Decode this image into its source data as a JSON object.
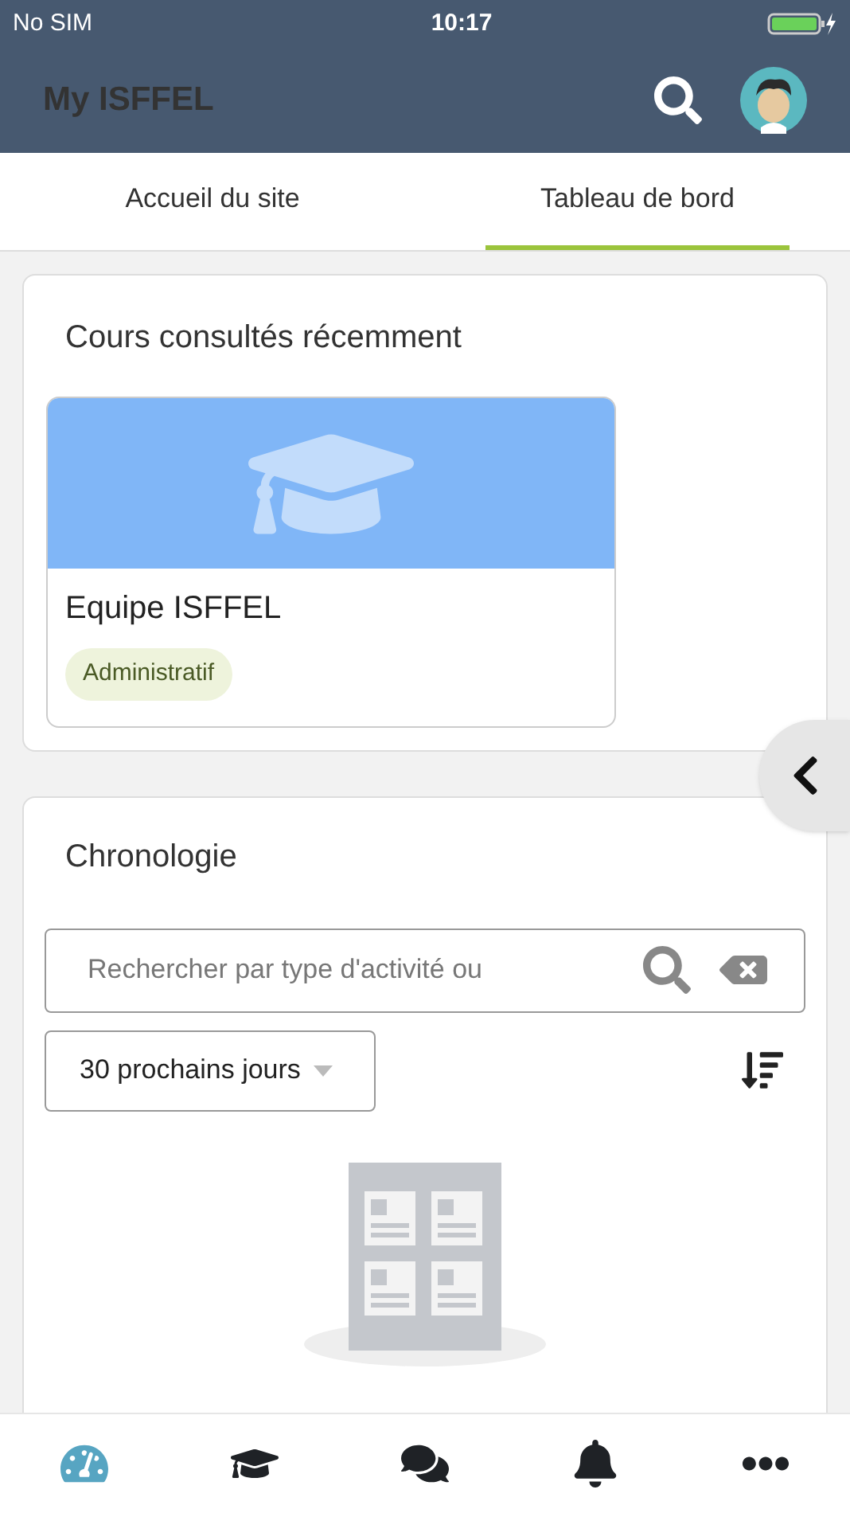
{
  "status_bar": {
    "carrier": "No SIM",
    "time": "10:17"
  },
  "header": {
    "title": "My ISFFEL"
  },
  "tabs": [
    {
      "label": "Accueil du site",
      "selected": false
    },
    {
      "label": "Tableau de bord",
      "selected": true
    }
  ],
  "recent_courses": {
    "title": "Cours consultés récemment",
    "courses": [
      {
        "name": "Equipe ISFFEL",
        "category": "Administratif"
      }
    ]
  },
  "timeline": {
    "title": "Chronologie",
    "search": {
      "placeholder": "Rechercher par type d'activité ou"
    },
    "filter": {
      "value": "30 prochains jours"
    }
  },
  "bottom_nav": [
    {
      "kind": "dashboard",
      "selected": true
    },
    {
      "kind": "courses",
      "selected": false
    },
    {
      "kind": "messages",
      "selected": false
    },
    {
      "kind": "notifications",
      "selected": false
    },
    {
      "kind": "more",
      "selected": false
    }
  ]
}
